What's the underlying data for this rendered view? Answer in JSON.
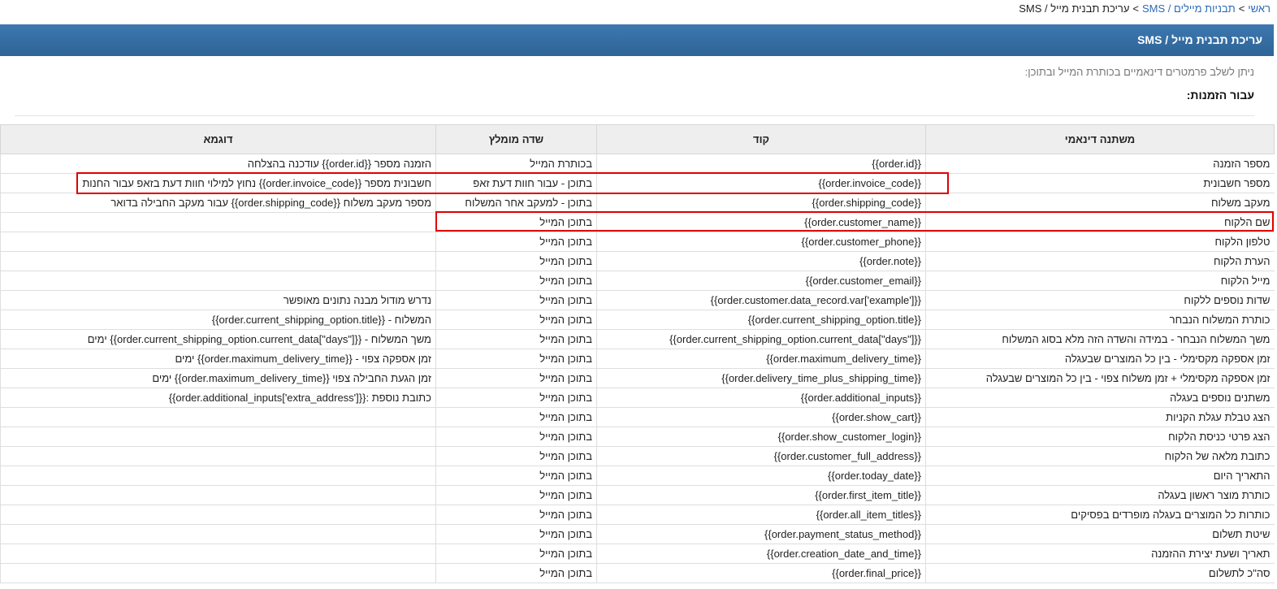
{
  "breadcrumb": {
    "home": "ראשי",
    "parent": "תבניות מיילים / SMS",
    "current": "עריכת תבנית מייל / SMS"
  },
  "header": {
    "title": "עריכת תבנית מייל / SMS"
  },
  "intro_text": "ניתן לשלב פרמטרים דינאמיים בכותרת המייל ובתוכן:",
  "section_title": "עבור הזמנות:",
  "table": {
    "headers": [
      "משתנה דינאמי",
      "קוד",
      "שדה מומלץ",
      "דוגמא"
    ],
    "rows": [
      [
        "מספר הזמנה",
        "{{order.id}}",
        "בכותרת המייל",
        "הזמנה מספר {{order.id}} עודכנה בהצלחה"
      ],
      [
        "מספר חשבונית",
        "{{order.invoice_code}}",
        "בתוכן - עבור חוות דעת זאפ",
        "חשבונית מספר {{order.invoice_code}} נחוץ למילוי חוות דעת בזאפ עבור החנות"
      ],
      [
        "מעקב משלוח",
        "{{order.shipping_code}}",
        "בתוכן - למעקב אחר המשלוח",
        "מספר מעקב משלוח {{order.shipping_code}} עבור מעקב החבילה בדואר"
      ],
      [
        "שם הלקוח",
        "{{order.customer_name}}",
        "בתוכן המייל",
        ""
      ],
      [
        "טלפון הלקוח",
        "{{order.customer_phone}}",
        "בתוכן המייל",
        ""
      ],
      [
        "הערת הלקוח",
        "{{order.note}}",
        "בתוכן המייל",
        ""
      ],
      [
        "מייל הלקוח",
        "{{order.customer_email}}",
        "בתוכן המייל",
        ""
      ],
      [
        "שדות נוספים ללקוח",
        "{{order.customer.data_record.var['example']}}",
        "בתוכן המייל",
        "נדרש מודול מבנה נתונים מאופשר"
      ],
      [
        "כותרת המשלוח הנבחר",
        "{{order.current_shipping_option.title}}",
        "בתוכן המייל",
        "המשלוח - {{order.current_shipping_option.title}}"
      ],
      [
        "משך המשלוח הנבחר - במידה והשדה הזה מלא בסוג המשלוח",
        "{{order.current_shipping_option.current_data[\"days\"]}}",
        "בתוכן המייל",
        "משך המשלוח - {{order.current_shipping_option.current_data[\"days\"]}} ימים"
      ],
      [
        "זמן אספקה מקסימלי - בין כל המוצרים שבעגלה",
        "{{order.maximum_delivery_time}}",
        "בתוכן המייל",
        "זמן אספקה צפוי - {{order.maximum_delivery_time}} ימים"
      ],
      [
        "זמן אספקה מקסימלי + זמן משלוח צפוי - בין כל המוצרים שבעגלה",
        "{{order.delivery_time_plus_shipping_time}}",
        "בתוכן המייל",
        "זמן הגעת החבילה צפוי {{order.maximum_delivery_time}} ימים"
      ],
      [
        "משתנים נוספים בעגלה",
        "{{order.additional_inputs}}",
        "בתוכן המייל",
        "כתובת נוספת :{{order.additional_inputs['extra_address']}}"
      ],
      [
        "הצג טבלת עגלת הקניות",
        "{{order.show_cart}}",
        "בתוכן המייל",
        ""
      ],
      [
        "הצג פרטי כניסת הלקוח",
        "{{order.show_customer_login}}",
        "בתוכן המייל",
        ""
      ],
      [
        "כתובת מלאה של הלקוח",
        "{{order.customer_full_address}}",
        "בתוכן המייל",
        ""
      ],
      [
        "התאריך היום",
        "{{order.today_date}}",
        "בתוכן המייל",
        ""
      ],
      [
        "כותרת מוצר ראשון בעגלה",
        "{{order.first_item_title}}",
        "בתוכן המייל",
        ""
      ],
      [
        "כותרות כל המוצרים בעגלה מופרדים בפסיקים",
        "{{order.all_item_titles}}",
        "בתוכן המייל",
        ""
      ],
      [
        "שיטת תשלום",
        "{{order.payment_status_method}}",
        "בתוכן המייל",
        ""
      ],
      [
        "תאריך ושעת יצירת ההזמנה",
        "{{order.creation_date_and_time}}",
        "בתוכן המייל",
        ""
      ],
      [
        "סה\"כ לתשלום",
        "{{order.final_price}}",
        "בתוכן המייל",
        ""
      ]
    ]
  },
  "colors": {
    "header_bar": "#2e6496",
    "link": "#2a6bb5",
    "highlight": "#e00000"
  }
}
